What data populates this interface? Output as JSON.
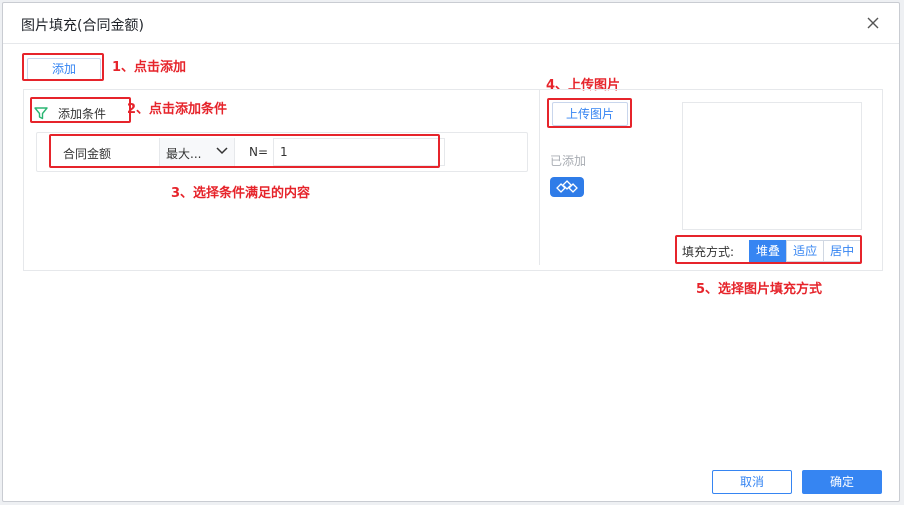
{
  "dialog": {
    "title": "图片填充(合同金额)"
  },
  "toolbar": {
    "add_label": "添加"
  },
  "condition": {
    "add_label": "添加条件",
    "field": "合同金额",
    "operator": "最大...",
    "n_label": "N=",
    "n_value": "1"
  },
  "image": {
    "upload_label": "上传图片",
    "added_label": "已添加"
  },
  "fill": {
    "label": "填充方式:",
    "options": [
      "堆叠",
      "适应",
      "居中"
    ],
    "selected": "堆叠"
  },
  "annotations": {
    "step1": "1、点击添加",
    "step2": "2、点击添加条件",
    "step3": "3、选择条件满足的内容",
    "step4": "4、上传图片",
    "step5": "5、选择图片填充方式"
  },
  "footer": {
    "cancel_label": "取消",
    "ok_label": "确定"
  },
  "colors": {
    "accent": "#3685f2",
    "annotation": "#e6242b",
    "funnel": "#2bb673"
  }
}
